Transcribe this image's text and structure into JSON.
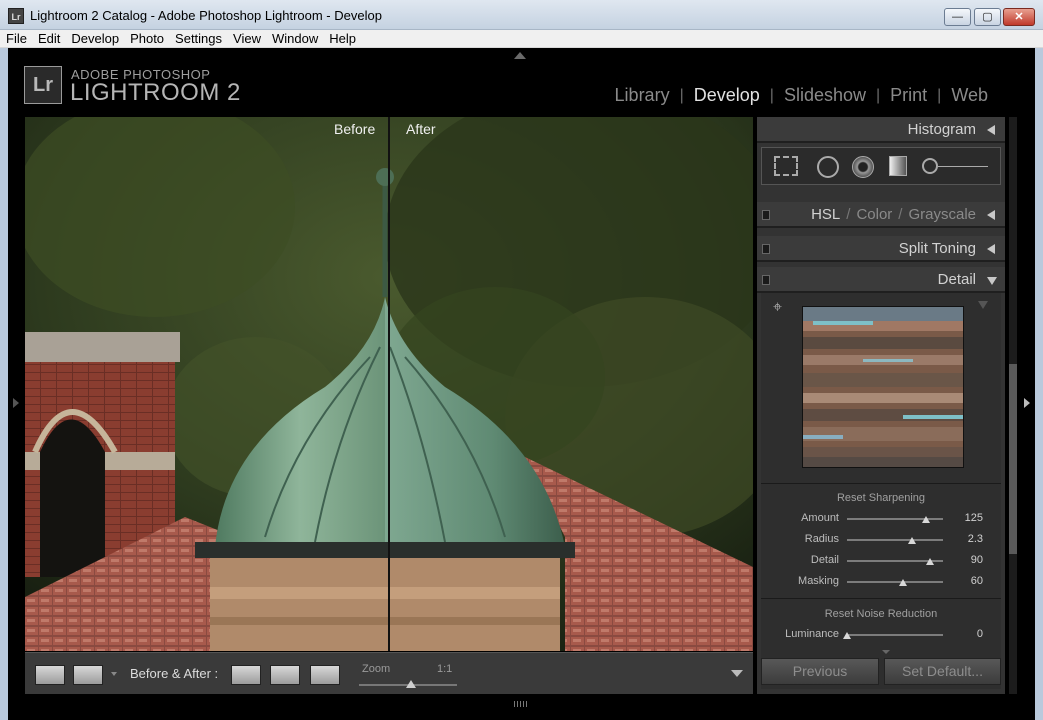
{
  "window": {
    "title": "Lightroom 2 Catalog - Adobe Photoshop Lightroom - Develop",
    "app_icon_label": "Lr",
    "controls": {
      "minimize": "—",
      "maximize": "▢",
      "close": "✕"
    }
  },
  "menu": [
    "File",
    "Edit",
    "Develop",
    "Photo",
    "Settings",
    "View",
    "Window",
    "Help"
  ],
  "logo": {
    "mark": "Lr",
    "line1": "ADOBE PHOTOSHOP",
    "line2": "LIGHTROOM 2"
  },
  "modules": [
    {
      "label": "Library",
      "active": false
    },
    {
      "label": "Develop",
      "active": true
    },
    {
      "label": "Slideshow",
      "active": false
    },
    {
      "label": "Print",
      "active": false
    },
    {
      "label": "Web",
      "active": false
    }
  ],
  "view": {
    "before_label": "Before",
    "after_label": "After"
  },
  "toolbar": {
    "before_after_label": "Before & After :",
    "zoom_label": "Zoom",
    "zoom_value": "1:1"
  },
  "panels": {
    "histogram": "Histogram",
    "hsl": {
      "hsl": "HSL",
      "color": "Color",
      "grayscale": "Grayscale",
      "sep": "/"
    },
    "split_toning": "Split Toning",
    "detail": "Detail"
  },
  "sharpening": {
    "reset_label": "Reset Sharpening",
    "sliders": [
      {
        "label": "Amount",
        "value": "125",
        "fraction": 0.82
      },
      {
        "label": "Radius",
        "value": "2.3",
        "fraction": 0.68
      },
      {
        "label": "Detail",
        "value": "90",
        "fraction": 0.86
      },
      {
        "label": "Masking",
        "value": "60",
        "fraction": 0.58
      }
    ]
  },
  "noise": {
    "reset_label": "Reset Noise Reduction",
    "sliders": [
      {
        "label": "Luminance",
        "value": "0",
        "fraction": 0.0
      }
    ]
  },
  "buttons": {
    "previous": "Previous",
    "set_default": "Set Default..."
  },
  "colors": {
    "panel_bg": "#333333",
    "active_module": "#e2e2e2",
    "inactive_module": "#8a8a8a",
    "window_border": "#b9c9dc"
  }
}
